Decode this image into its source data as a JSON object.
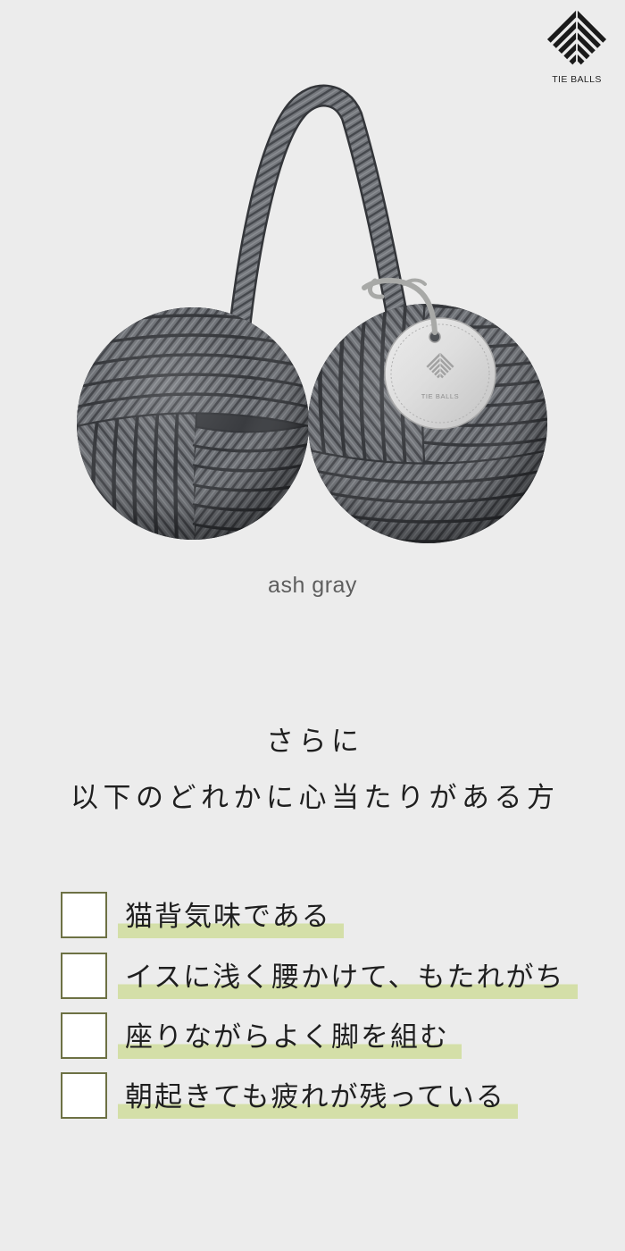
{
  "brand": {
    "logo_text": "TIE BALLS"
  },
  "product": {
    "color_name": "ash gray",
    "tag_text": "TIE BALLS"
  },
  "heading": {
    "line1": "さらに",
    "line2": "以下のどれかに心当たりがある方"
  },
  "checklist": {
    "items": [
      {
        "label": "猫背気味である",
        "checked": false
      },
      {
        "label": "イスに浅く腰かけて、もたれがち",
        "checked": false
      },
      {
        "label": "座りながらよく脚を組む",
        "checked": false
      },
      {
        "label": "朝起きても疲れが残っている",
        "checked": false
      }
    ]
  },
  "icons": {
    "brand_mark": "striped-diamond-logo",
    "tag_mark": "striped-diamond-logo",
    "checkbox": "empty-checkbox"
  },
  "colors": {
    "background": "#ececec",
    "text": "#1f1f1f",
    "caption": "#5e5e5e",
    "highlight": "#d4dfa8",
    "checkbox_border": "#6d7144",
    "checkbox_fill": "#ffffff",
    "rope": "#6e7176",
    "tag": "#dedede"
  }
}
